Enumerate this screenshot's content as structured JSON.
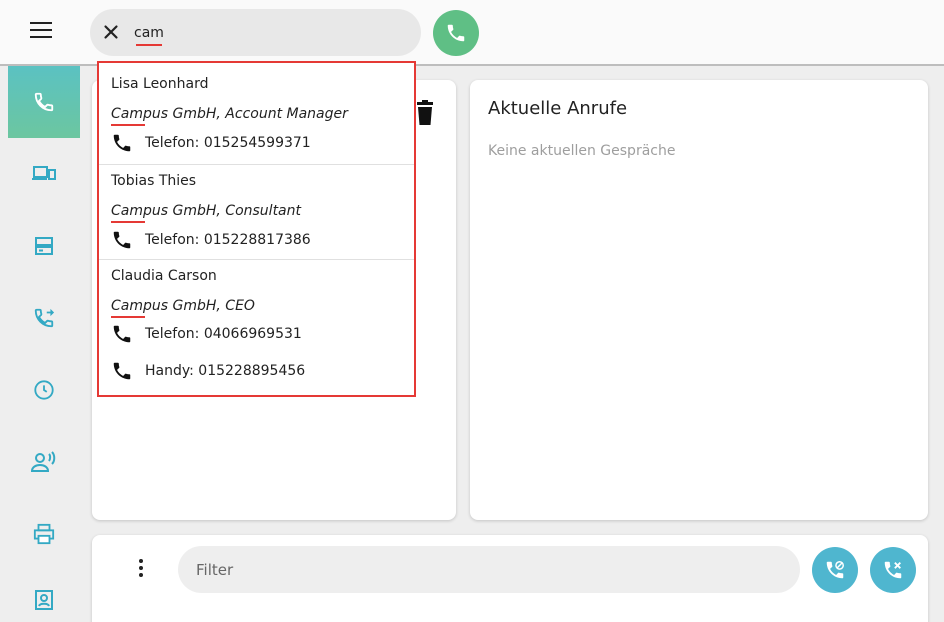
{
  "search": {
    "value": "cam",
    "placeholder": ""
  },
  "contacts": [
    {
      "name": "Lisa Leonhard",
      "company": "Campus GmbH, Account Manager",
      "phones": [
        {
          "label": "Telefon: 015254599371"
        }
      ]
    },
    {
      "name": "Tobias Thies",
      "company": "Campus GmbH, Consultant",
      "phones": [
        {
          "label": "Telefon: 015228817386"
        }
      ]
    },
    {
      "name": "Claudia Carson",
      "company": "Campus GmbH, CEO",
      "phones": [
        {
          "label": "Telefon: 04066969531"
        },
        {
          "label": "Handy: 015228895456"
        }
      ]
    }
  ],
  "current_calls": {
    "title": "Aktuelle Anrufe",
    "empty_text": "Keine aktuellen Gespräche"
  },
  "filter": {
    "placeholder": "Filter"
  },
  "sidebar": {
    "items": [
      {
        "icon": "phone-icon",
        "active": true
      },
      {
        "icon": "devices-icon",
        "active": false
      },
      {
        "icon": "storage-icon",
        "active": false
      },
      {
        "icon": "call-forward-icon",
        "active": false
      },
      {
        "icon": "clock-icon",
        "active": false
      },
      {
        "icon": "voice-user-icon",
        "active": false
      },
      {
        "icon": "printer-icon",
        "active": false
      },
      {
        "icon": "contact-card-icon",
        "active": false
      }
    ]
  },
  "colors": {
    "accent_green": "#5fbf85",
    "accent_teal": "#4fb6cf",
    "sidebar_icon": "#33a9c4",
    "highlight_red": "#e53935"
  }
}
